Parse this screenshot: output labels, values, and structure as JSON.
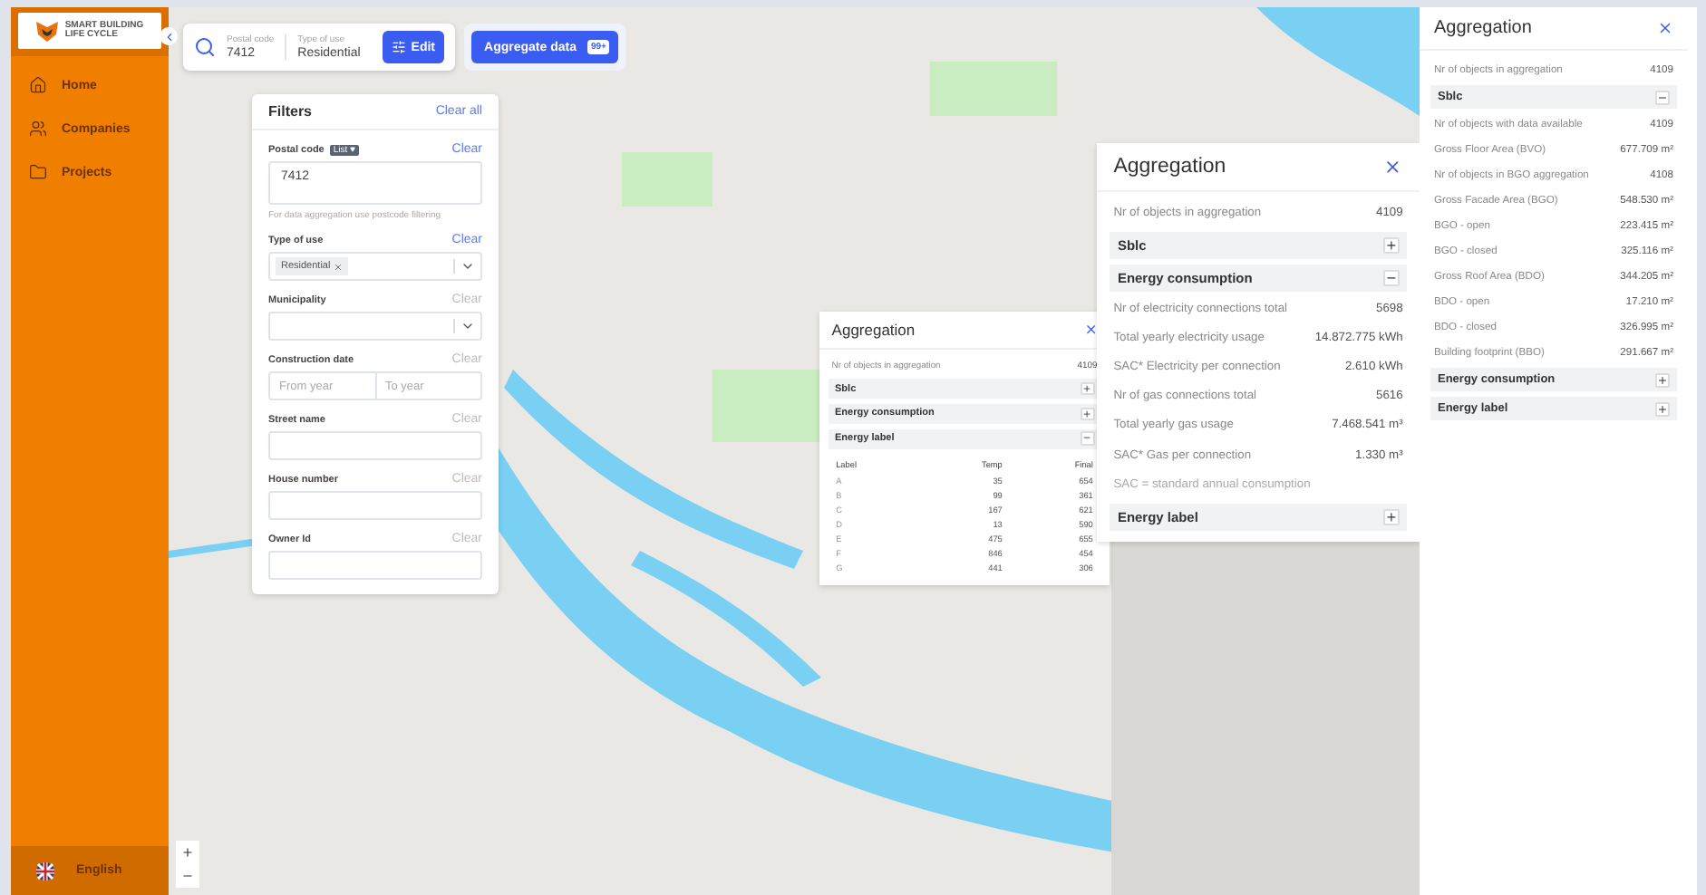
{
  "sidebar": {
    "logo_lines": [
      "SMART BUILDING",
      "LIFE CYCLE"
    ],
    "nav": [
      {
        "label": "Home"
      },
      {
        "label": "Companies"
      },
      {
        "label": "Projects"
      }
    ],
    "language": "English"
  },
  "search_bar": {
    "fields": [
      {
        "label": "Postal code",
        "value": "7412"
      },
      {
        "label": "Type of use",
        "value": "Residential"
      }
    ],
    "edit_button": "Edit",
    "aggregate_button": "Aggregate data",
    "aggregate_badge": "99+"
  },
  "filters": {
    "title": "Filters",
    "clear_all": "Clear all",
    "fields": [
      {
        "kind": "textarea",
        "label": "Postal code",
        "badge": "List",
        "clear": "Clear",
        "clear_active": true,
        "value": "7412",
        "hint": "For data aggregation use postcode filtering"
      },
      {
        "kind": "multiselect",
        "label": "Type of use",
        "clear": "Clear",
        "clear_active": true,
        "tags": [
          "Residential"
        ]
      },
      {
        "kind": "select",
        "label": "Municipality",
        "clear": "Clear",
        "clear_active": false
      },
      {
        "kind": "range",
        "label": "Construction date",
        "clear": "Clear",
        "clear_active": false,
        "placeholders": [
          "From year",
          "To year"
        ]
      },
      {
        "kind": "text",
        "label": "Street name",
        "clear": "Clear",
        "clear_active": false
      },
      {
        "kind": "text",
        "label": "House number",
        "clear": "Clear",
        "clear_active": false
      },
      {
        "kind": "text",
        "label": "Owner Id",
        "clear": "Clear",
        "clear_active": false
      }
    ]
  },
  "map_panels": [
    {
      "title": "Aggregation",
      "summary": {
        "label": "Nr of objects in aggregation",
        "value": "4109"
      },
      "sections": [
        {
          "title": "Sblc",
          "expanded": false
        },
        {
          "title": "Energy consumption",
          "expanded": false
        },
        {
          "title": "Energy label",
          "expanded": true,
          "table": {
            "columns": [
              "Label",
              "Temp",
              "Final"
            ],
            "rows": [
              [
                "A",
                "35",
                "654"
              ],
              [
                "B",
                "99",
                "361"
              ],
              [
                "C",
                "167",
                "621"
              ],
              [
                "D",
                "13",
                "590"
              ],
              [
                "E",
                "475",
                "655"
              ],
              [
                "F",
                "846",
                "454"
              ],
              [
                "G",
                "441",
                "306"
              ]
            ]
          }
        }
      ]
    },
    {
      "title": "Aggregation",
      "summary": {
        "label": "Nr of objects in aggregation",
        "value": "4109"
      },
      "sections": [
        {
          "title": "Sblc",
          "expanded": false
        },
        {
          "title": "Energy consumption",
          "expanded": true,
          "rows": [
            {
              "label": "Nr of electricity connections total",
              "value": "5698"
            },
            {
              "label": "Total yearly electricity usage",
              "value": "14.872.775 kWh"
            },
            {
              "label": "SAC* Electricity per connection",
              "value": "2.610 kWh"
            },
            {
              "label": "Nr of gas connections total",
              "value": "5616"
            },
            {
              "label": "Total yearly gas usage",
              "value": "7.468.541 m³"
            },
            {
              "label": "SAC* Gas per connection",
              "value": "1.330 m³"
            }
          ],
          "note": "SAC = standard annual consumption"
        },
        {
          "title": "Energy label",
          "expanded": false
        }
      ]
    }
  ],
  "side_panel": {
    "title": "Aggregation",
    "summary": {
      "label": "Nr of objects in aggregation",
      "value": "4109"
    },
    "sections": [
      {
        "title": "Sblc",
        "expanded": true,
        "rows": [
          {
            "label": "Nr of objects with data available",
            "value": "4109"
          },
          {
            "label": "Gross Floor Area (BVO)",
            "value": "677.709 m²"
          },
          {
            "label": "Nr of objects in BGO aggregation",
            "value": "4108"
          },
          {
            "label": "Gross Facade Area (BGO)",
            "value": "548.530 m²"
          },
          {
            "label": "BGO - open",
            "value": "223.415 m²"
          },
          {
            "label": "BGO - closed",
            "value": "325.116 m²"
          },
          {
            "label": "Gross Roof Area (BDO)",
            "value": "344.205 m²"
          },
          {
            "label": "BDO - open",
            "value": "17.210 m²"
          },
          {
            "label": "BDO - closed",
            "value": "326.995 m²"
          },
          {
            "label": "Building footprint (BBO)",
            "value": "291.667 m²"
          }
        ]
      },
      {
        "title": "Energy consumption",
        "expanded": false
      },
      {
        "title": "Energy label",
        "expanded": false
      }
    ]
  }
}
